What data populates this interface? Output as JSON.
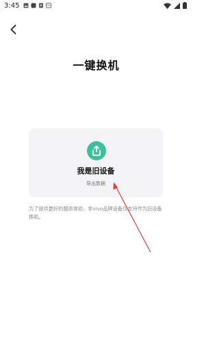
{
  "status_bar": {
    "time": "3:45",
    "notification_icons": [
      "image-icon",
      "app-icon",
      "file-icon",
      "message-icon"
    ],
    "system_icons": [
      "wifi-icon",
      "signal-icon",
      "battery-icon"
    ]
  },
  "header": {
    "back_icon": "chevron-left-icon"
  },
  "page": {
    "title": "一键换机"
  },
  "card": {
    "icon": "export-icon",
    "icon_color": "#3cc09a",
    "title": "我是旧设备",
    "subtitle": "导出数据"
  },
  "note": {
    "text": "为了提供更好的服务体验，非vivo品牌设备仅支持作为旧设备换机。"
  },
  "annotation": {
    "arrow_color": "#e03a3a"
  }
}
